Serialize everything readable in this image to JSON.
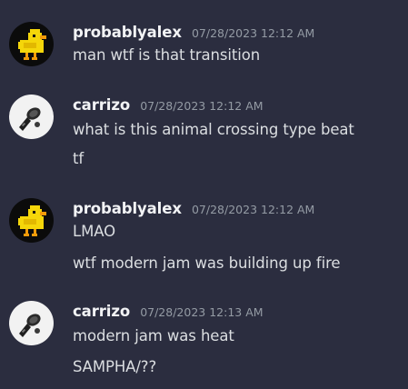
{
  "messages": [
    {
      "username": "probablyalex",
      "timestamp": "07/28/2023 12:12 AM",
      "avatar_icon": "pixel-duck-icon",
      "lines": [
        "man wtf is that transition"
      ]
    },
    {
      "username": "carrizo",
      "timestamp": "07/28/2023 12:12 AM",
      "avatar_icon": "microphone-icon",
      "lines": [
        "what is this animal crossing type beat",
        "tf"
      ]
    },
    {
      "username": "probablyalex",
      "timestamp": "07/28/2023 12:12 AM",
      "avatar_icon": "pixel-duck-icon",
      "lines": [
        "LMAO",
        "wtf modern jam was building up fire"
      ]
    },
    {
      "username": "carrizo",
      "timestamp": "07/28/2023 12:13 AM",
      "avatar_icon": "microphone-icon",
      "lines": [
        "modern jam was heat",
        "SAMPHA/??"
      ]
    }
  ],
  "colors": {
    "background": "#2b2d3f",
    "username": "#f2f3f5",
    "message_text": "#dbdee1",
    "timestamp": "#949ba4",
    "duck_avatar_bg": "#0b0b0b",
    "duck_yellow": "#f5d60a",
    "mic_avatar_bg": "#f2f2f2"
  }
}
